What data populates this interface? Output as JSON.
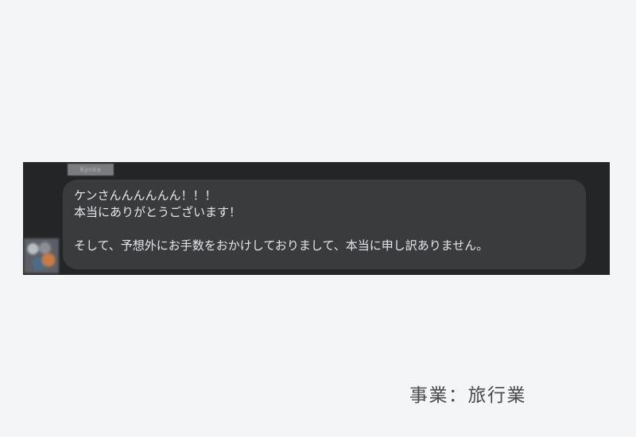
{
  "chat": {
    "sender_name": "Kyoka",
    "message_lines": [
      "ケンさんんんんんん！！！",
      "本当にありがとうございます！",
      "",
      "そして、予想外にお手数をおかけしておりまして、本当に申し訳ありません。"
    ]
  },
  "caption": {
    "business_label": "事業：旅行業"
  },
  "colors": {
    "page_background": "#f4f5f7",
    "chat_background": "#242526",
    "bubble_background": "#3a3b3c",
    "bubble_text": "#e4e6eb",
    "caption_text": "#4a4a4a"
  }
}
